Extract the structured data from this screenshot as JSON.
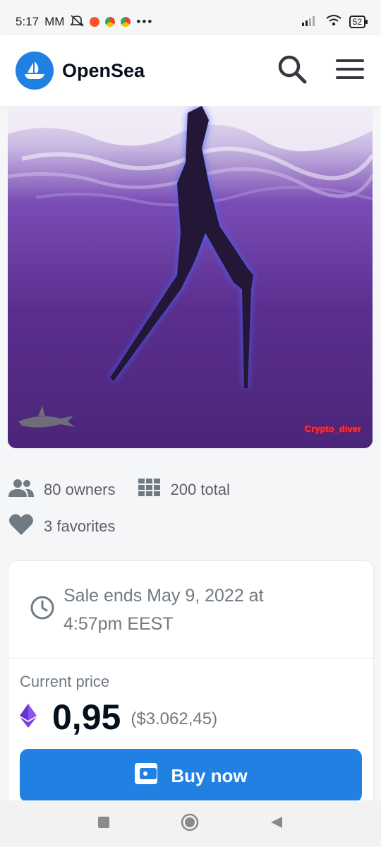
{
  "status_bar": {
    "time": "5:17",
    "carrier": "MM",
    "battery": "52"
  },
  "header": {
    "brand": "OpenSea",
    "logo_icon": "sailboat-icon",
    "search_icon": "search-icon",
    "menu_icon": "hamburger-menu-icon"
  },
  "artwork": {
    "watermark": "Crypto_diver"
  },
  "stats": {
    "owners": "80 owners",
    "total": "200 total",
    "favorites": "3 favorites"
  },
  "sale": {
    "ends_text": "Sale ends May 9, 2022 at 4:57pm EEST",
    "price_label": "Current price",
    "price": "0,95",
    "price_usd": "($3.062,45)",
    "buy_label": "Buy now"
  },
  "colors": {
    "accent": "#2081e2",
    "eth": "#7b3fe4"
  }
}
